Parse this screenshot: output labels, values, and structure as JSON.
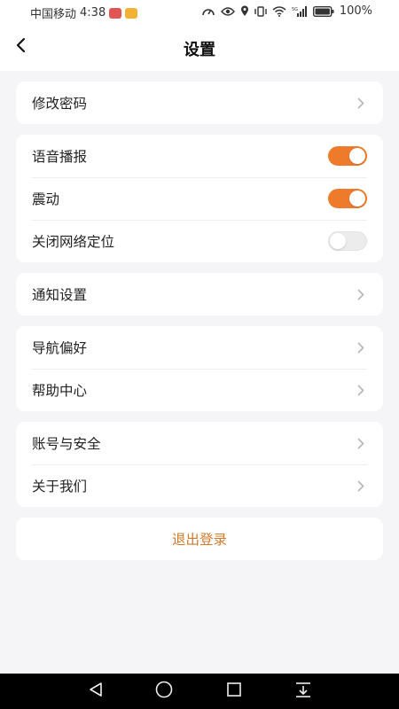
{
  "status_bar": {
    "carrier": "中国移动",
    "time": "4:38",
    "battery": "100%",
    "icons": [
      "speed-icon",
      "eye-icon",
      "location-icon",
      "vibrate-icon",
      "wifi-icon",
      "5g-signal-icon",
      "battery-icon"
    ]
  },
  "header": {
    "title": "设置",
    "back_icon": "chevron-left-icon"
  },
  "groups": {
    "g1": {
      "password": "修改密码"
    },
    "g2": {
      "voice": "语音播报",
      "voice_on": true,
      "vibrate": "震动",
      "vibrate_on": true,
      "close_location": "关闭网络定位",
      "close_location_on": false
    },
    "g3": {
      "notify": "通知设置"
    },
    "g4": {
      "nav_pref": "导航偏好",
      "help": "帮助中心"
    },
    "g5": {
      "account": "账号与安全",
      "about": "关于我们"
    }
  },
  "logout": "退出登录",
  "colors": {
    "accent": "#ee7b2c",
    "logout_text": "#d07a2a",
    "background": "#f5f5f7"
  },
  "nav_bar": {
    "icons": [
      "back-triangle-icon",
      "home-circle-icon",
      "recents-square-icon",
      "notification-pull-icon"
    ]
  }
}
